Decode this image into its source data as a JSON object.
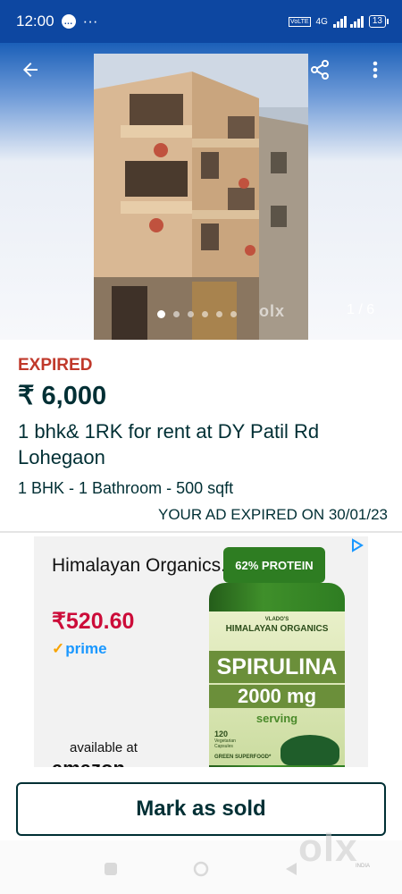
{
  "status_bar": {
    "time": "12:00",
    "chat_icon": "chat-bubble-icon",
    "more": "···",
    "network": "VoLTE",
    "signal_label": "4G",
    "battery": "13"
  },
  "gallery": {
    "counter": "1 / 6",
    "total_images": 6,
    "active_index": 1,
    "watermark": "olx"
  },
  "listing": {
    "status": "EXPIRED",
    "price": "₹ 6,000",
    "title": "1 bhk& 1RK for rent at DY Patil Rd Lohegaon",
    "specs": "1 BHK - 1 Bathroom - 500 sqft",
    "expired_note": "YOUR AD EXPIRED ON 30/01/23"
  },
  "ad": {
    "brand": "Himalayan Organics...",
    "price": "₹520.60",
    "prime": "prime",
    "available": "available at",
    "retailer": "amazon",
    "badge": "62% PROTEIN",
    "vlado": "VLADO'S",
    "label_brand": "HIMALAYAN ORGANICS",
    "product": "SPIRULINA",
    "dose": "2000 mg",
    "serving": "serving",
    "count": "120",
    "caps": "Vegetarian Capsules",
    "tag": "GREEN SUPERFOOD*"
  },
  "actions": {
    "mark_sold": "Mark as sold"
  },
  "watermark": {
    "brand": "olx",
    "region": "INDIA"
  },
  "colors": {
    "status_bar": "#0d47a1",
    "expired": "#c0392b",
    "text": "#002f34",
    "ad_price": "#cc0c39",
    "prime": "#1a98ff"
  }
}
